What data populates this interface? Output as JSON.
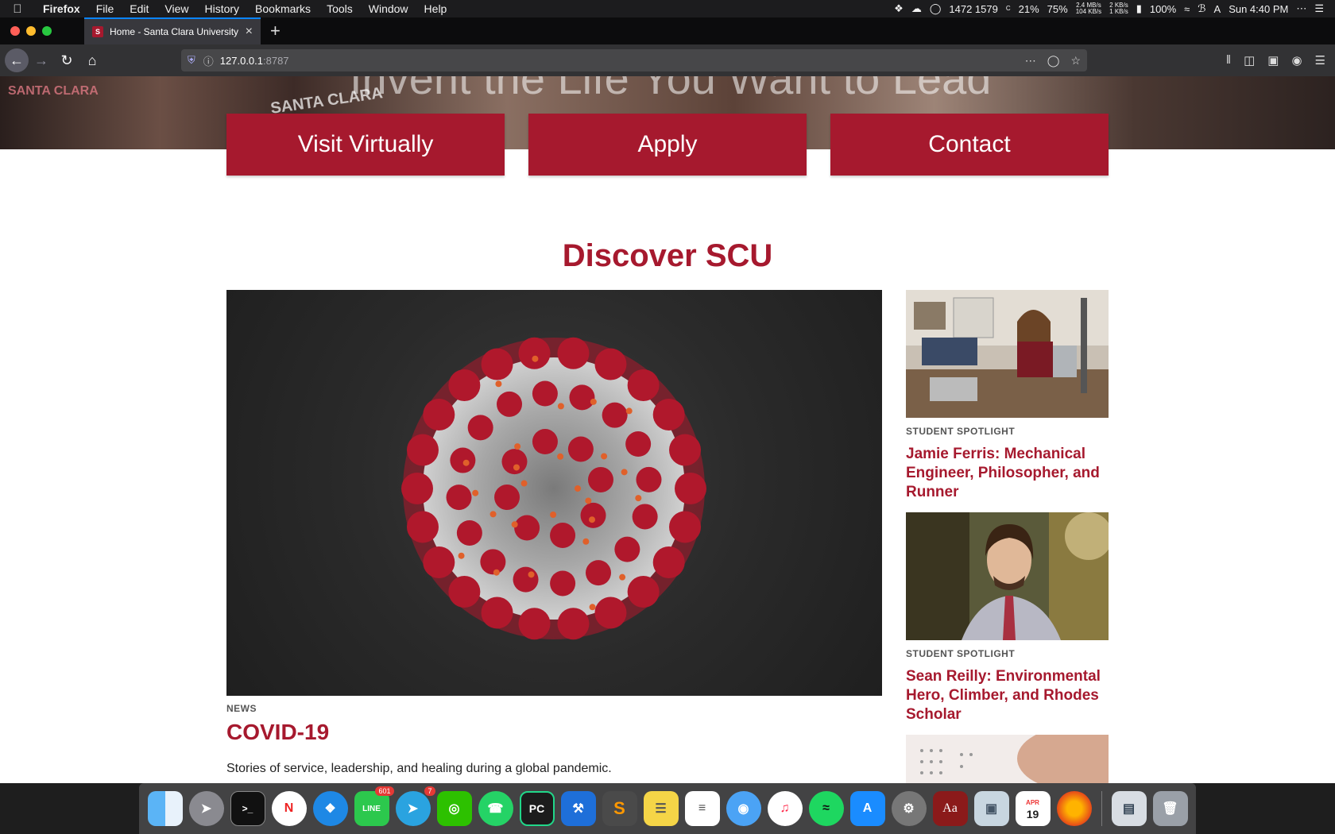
{
  "menubar": {
    "app_name": "Firefox",
    "items": [
      "File",
      "Edit",
      "View",
      "History",
      "Bookmarks",
      "Tools",
      "Window",
      "Help"
    ],
    "stats_cpu": "1472 1579",
    "stats_c": "C",
    "percent1": "21%",
    "percent2": "75%",
    "net_rw_top": "2.4 MB/s",
    "net_rw_bottom": "104 KB/s",
    "net2_top": "2 KB/s",
    "net2_bottom": "1 KB/s",
    "battery": "100%",
    "clock": "Sun 4:40 PM"
  },
  "browser": {
    "tab_title": "Home - Santa Clara University",
    "url_host": "127.0.0.1",
    "url_port": ":8787"
  },
  "hero": {
    "overlay_text": "Invent the Life You Want to Lead",
    "shirt_text": "SANTA CLARA",
    "shirt_text_left": "SANTA CLARA"
  },
  "cta": {
    "visit": "Visit Virtually",
    "apply": "Apply",
    "contact": "Contact"
  },
  "section_title": "Discover SCU",
  "feature": {
    "tag": "NEWS",
    "title": "COVID-19",
    "description": "Stories of service, leadership, and healing during a global pandemic."
  },
  "spotlights": [
    {
      "tag": "STUDENT SPOTLIGHT",
      "title": "Jamie Ferris: Mechanical Engineer, Philosopher, and Runner"
    },
    {
      "tag": "STUDENT SPOTLIGHT",
      "title": "Sean Reilly: Environmental Hero, Climber, and Rhodes Scholar"
    }
  ],
  "dock": {
    "line_badge": "601",
    "telegram_badge": "7",
    "calendar_month": "APR",
    "calendar_day": "19"
  },
  "colors": {
    "scu_red": "#a6192e",
    "virus_red": "#b0182c",
    "virus_grey": "#a8a8a8"
  }
}
